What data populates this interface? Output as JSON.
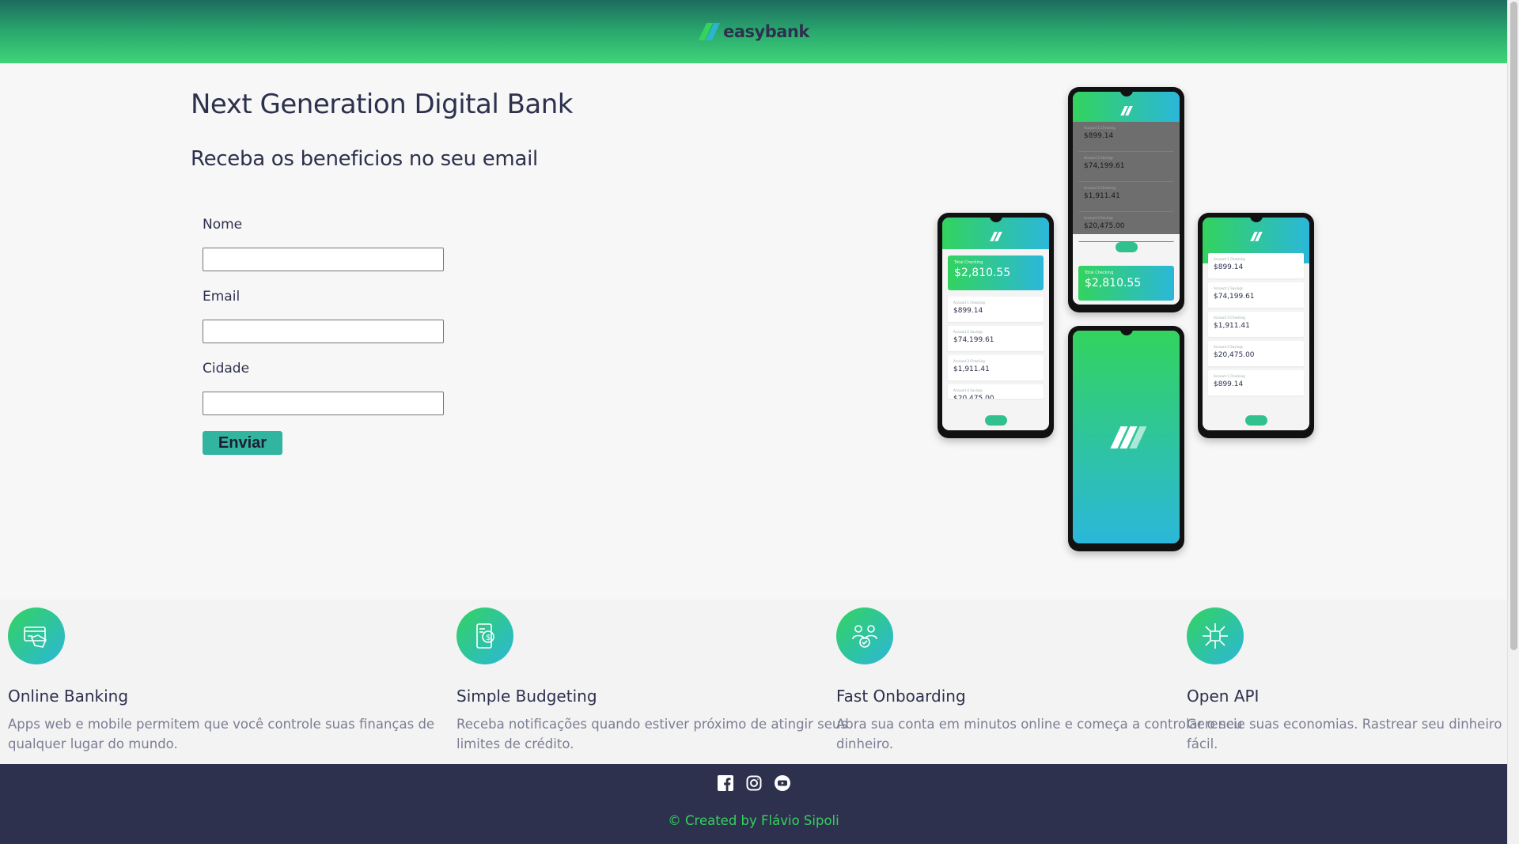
{
  "header": {
    "logo_text": "easybank",
    "logo_icon": "easybank-logo-icon"
  },
  "hero": {
    "title": "Next Generation Digital Bank",
    "subtitle": "Receba os beneficios no seu email"
  },
  "form": {
    "fields": [
      {
        "label": "Nome",
        "value": ""
      },
      {
        "label": "Email",
        "value": ""
      },
      {
        "label": "Cidade",
        "value": ""
      }
    ],
    "submit_label": "Enviar"
  },
  "phones": {
    "total_label": "Total Checking",
    "total_value": "$2,810.55",
    "accounts": [
      {
        "label": "Account 1 Checking",
        "value": "$899.14"
      },
      {
        "label": "Account 2 Savings",
        "value": "$74,199.61"
      },
      {
        "label": "Account 3 Checking",
        "value": "$1,911.41"
      },
      {
        "label": "Account 4 Savings",
        "value": "$20,475.00"
      },
      {
        "label": "Account 1 Checking",
        "value": "$899.14"
      }
    ]
  },
  "features": [
    {
      "icon": "online-banking-icon",
      "title": "Online Banking",
      "text": "Apps web e mobile permitem que você controle suas finanças de qualquer lugar do mundo."
    },
    {
      "icon": "budgeting-icon",
      "title": "Simple Budgeting",
      "text": "Receba notificações quando estiver próximo de atingir seus limites de crédito."
    },
    {
      "icon": "onboarding-icon",
      "title": "Fast Onboarding",
      "text": "Abra sua conta em minutos online e começa a controlar o seu dinheiro."
    },
    {
      "icon": "api-icon",
      "title": "Open API",
      "text": "Gerencie suas economias. Rastrear seu dinheiro nunca foi tão fácil."
    }
  ],
  "footer": {
    "socials": [
      "facebook-icon",
      "instagram-icon",
      "youtube-icon"
    ],
    "credit": "© Created by Flávio Sipoli"
  },
  "colors": {
    "primary_green": "#33d35e",
    "primary_cyan": "#2bb7da",
    "button": "#31b5a1",
    "dark_blue": "#2d314d",
    "muted_text": "#7b7e94"
  }
}
